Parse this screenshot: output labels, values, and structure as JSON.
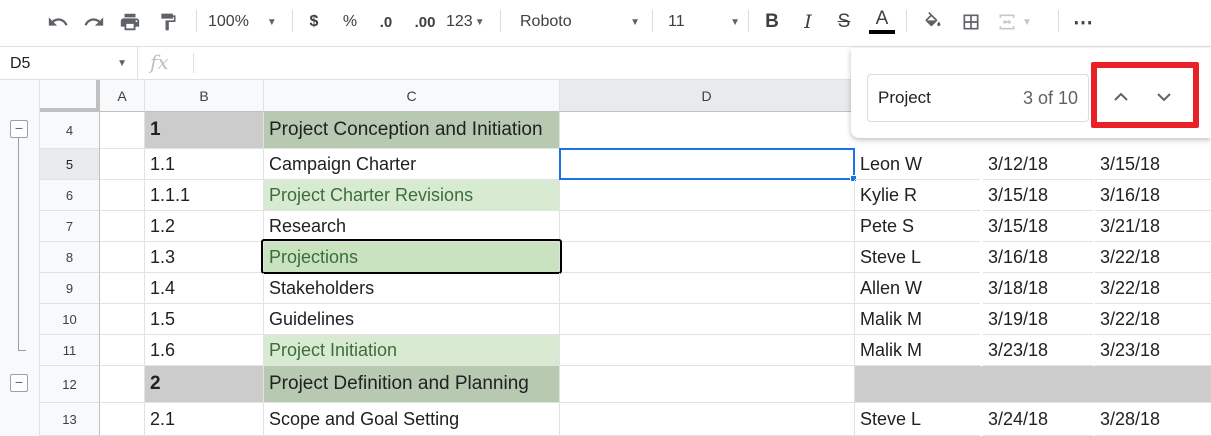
{
  "toolbar": {
    "zoom": "100%",
    "currency": "$",
    "percent": "%",
    "dec_decrease": ".0",
    "dec_increase": ".00",
    "number_format": "123",
    "font": "Roboto",
    "font_size": "11",
    "bold": "B",
    "italic": "I",
    "strike": "S",
    "text_color": "A",
    "more": "⋯"
  },
  "formula_bar": {
    "name_box": "D5",
    "fx": "fx",
    "value": ""
  },
  "columns": [
    "A",
    "B",
    "C",
    "D"
  ],
  "find": {
    "query": "Project",
    "count": "3 of 10"
  },
  "rows": [
    {
      "num": "4",
      "b": "1",
      "c": "Project Conception and Initiation",
      "e": "",
      "f": "",
      "g": ""
    },
    {
      "num": "5",
      "b": "1.1",
      "c": "Campaign Charter",
      "e": "Leon W",
      "f": "3/12/18",
      "g": "3/15/18"
    },
    {
      "num": "6",
      "b": "1.1.1",
      "c": "Project Charter Revisions",
      "e": "Kylie R",
      "f": "3/15/18",
      "g": "3/16/18"
    },
    {
      "num": "7",
      "b": "1.2",
      "c": "Research",
      "e": "Pete S",
      "f": "3/15/18",
      "g": "3/21/18"
    },
    {
      "num": "8",
      "b": "1.3",
      "c": "Projections",
      "e": "Steve L",
      "f": "3/16/18",
      "g": "3/22/18"
    },
    {
      "num": "9",
      "b": "1.4",
      "c": "Stakeholders",
      "e": "Allen W",
      "f": "3/18/18",
      "g": "3/22/18"
    },
    {
      "num": "10",
      "b": "1.5",
      "c": "Guidelines",
      "e": "Malik M",
      "f": "3/19/18",
      "g": "3/22/18"
    },
    {
      "num": "11",
      "b": "1.6",
      "c": "Project Initiation",
      "e": "Malik M",
      "f": "3/23/18",
      "g": "3/23/18"
    },
    {
      "num": "12",
      "b": "2",
      "c": "Project Definition and Planning",
      "e": "",
      "f": "",
      "g": ""
    },
    {
      "num": "13",
      "b": "2.1",
      "c": "Scope and Goal Setting",
      "e": "Steve L",
      "f": "3/24/18",
      "g": "3/28/18"
    }
  ],
  "colors": {
    "header_gray": "#cccccc",
    "header_green": "#b7c9b1",
    "light_green": "#d9ead3",
    "selection_blue": "#1a73e8",
    "highlight_red": "#ea2027"
  }
}
